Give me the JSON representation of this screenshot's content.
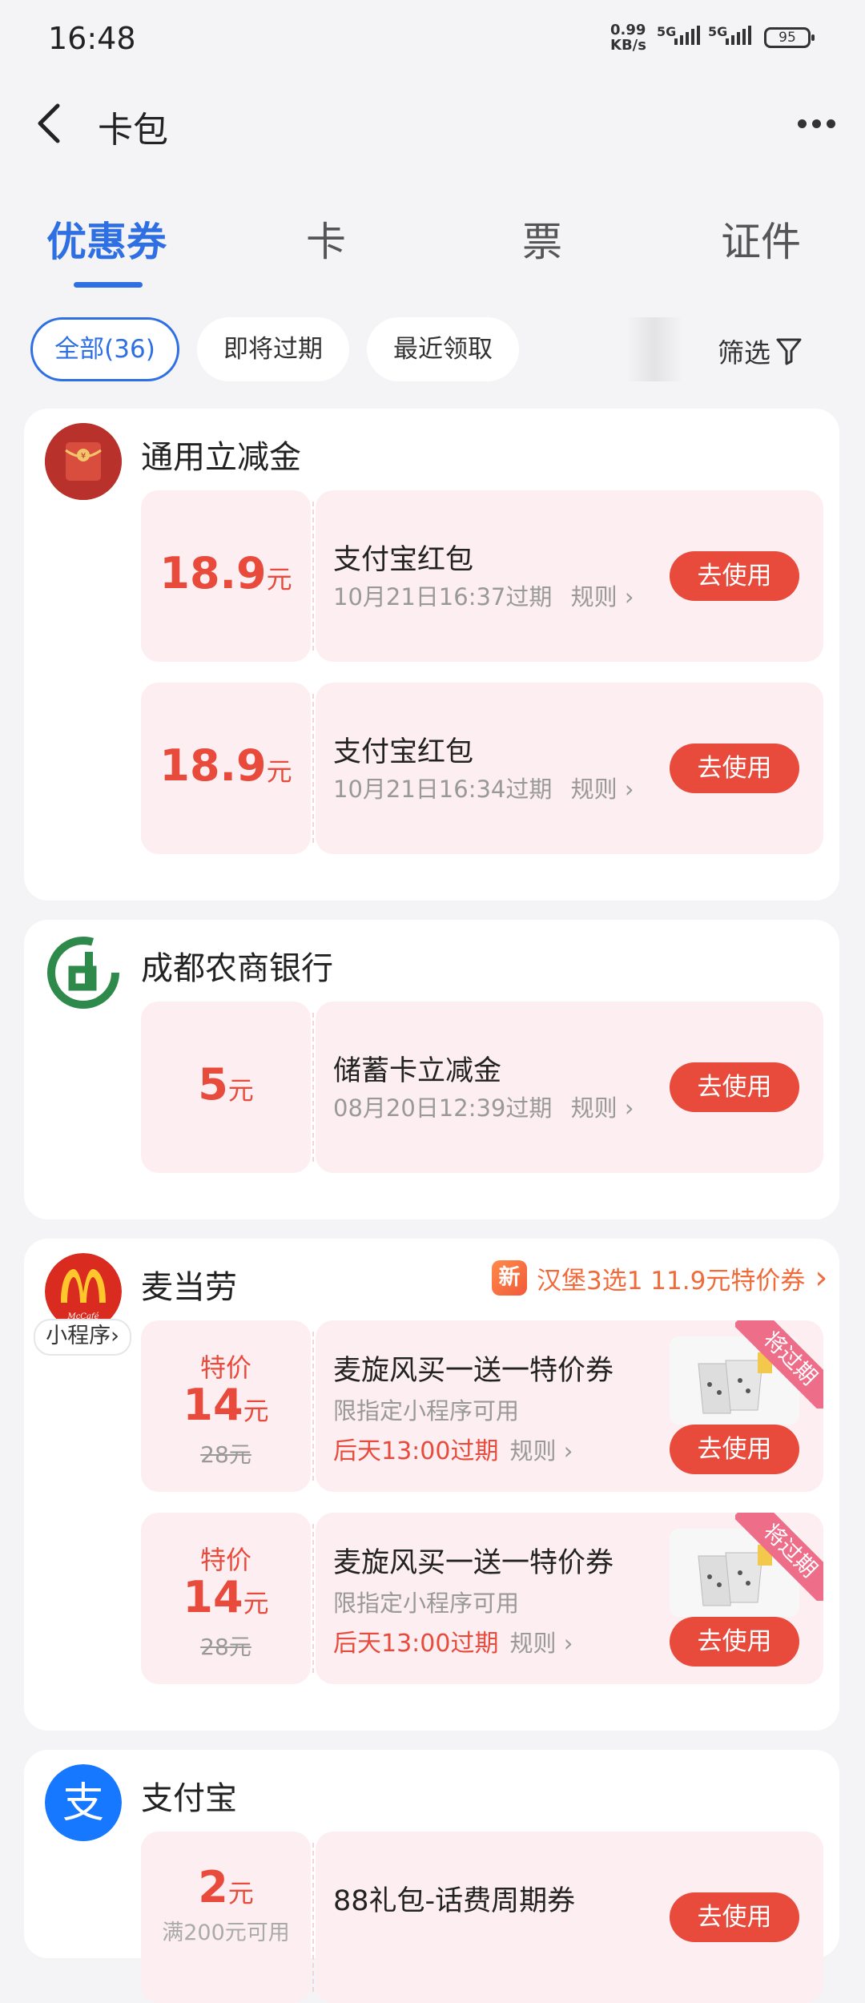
{
  "status_bar": {
    "time": "16:48",
    "net_speed_value": "0.99",
    "net_speed_unit": "KB/s",
    "sim1": "5G",
    "sim2": "5G",
    "battery": "95"
  },
  "header": {
    "title": "卡包"
  },
  "tabs": [
    {
      "label": "优惠券",
      "active": true
    },
    {
      "label": "卡"
    },
    {
      "label": "票"
    },
    {
      "label": "证件"
    }
  ],
  "filters": {
    "chips": [
      "全部(36)",
      "即将过期",
      "最近领取"
    ],
    "filter_label": "筛选"
  },
  "colors": {
    "accent": "#2f6fe4",
    "coupon_red": "#e84a3c",
    "coupon_bg": "#fdeef1"
  },
  "groups": [
    {
      "merchant": "通用立减金",
      "icon": "red-envelope-icon",
      "coupons": [
        {
          "amount": "18.9",
          "unit": "元",
          "title": "支付宝红包",
          "expiry": "10月21日16:37过期",
          "rule": "规则",
          "button": "去使用"
        },
        {
          "amount": "18.9",
          "unit": "元",
          "title": "支付宝红包",
          "expiry": "10月21日16:34过期",
          "rule": "规则",
          "button": "去使用"
        }
      ]
    },
    {
      "merchant": "成都农商银行",
      "icon": "bank-logo-icon",
      "coupons": [
        {
          "amount": "5",
          "unit": "元",
          "title": "储蓄卡立减金",
          "expiry": "08月20日12:39过期",
          "rule": "规则",
          "button": "去使用"
        }
      ]
    },
    {
      "merchant": "麦当劳",
      "icon": "mcdonalds-logo-icon",
      "logo_text": "McCafé",
      "tag": "小程序",
      "promo": {
        "badge": "新",
        "text": "汉堡3选1 11.9元特价券"
      },
      "coupons": [
        {
          "label": "特价",
          "amount": "14",
          "unit": "元",
          "original": "28元",
          "title": "麦旋风买一送一特价券",
          "subtitle": "限指定小程序可用",
          "expiry": "后天13:00过期",
          "rule": "规则",
          "button": "去使用",
          "ribbon": "将过期"
        },
        {
          "label": "特价",
          "amount": "14",
          "unit": "元",
          "original": "28元",
          "title": "麦旋风买一送一特价券",
          "subtitle": "限指定小程序可用",
          "expiry": "后天13:00过期",
          "rule": "规则",
          "button": "去使用",
          "ribbon": "将过期"
        }
      ]
    },
    {
      "merchant": "支付宝",
      "icon": "alipay-logo-icon",
      "coupons": [
        {
          "amount": "2",
          "unit": "元",
          "condition": "满200元可用",
          "title": "88礼包-话费周期券",
          "button": "去使用"
        }
      ]
    }
  ]
}
